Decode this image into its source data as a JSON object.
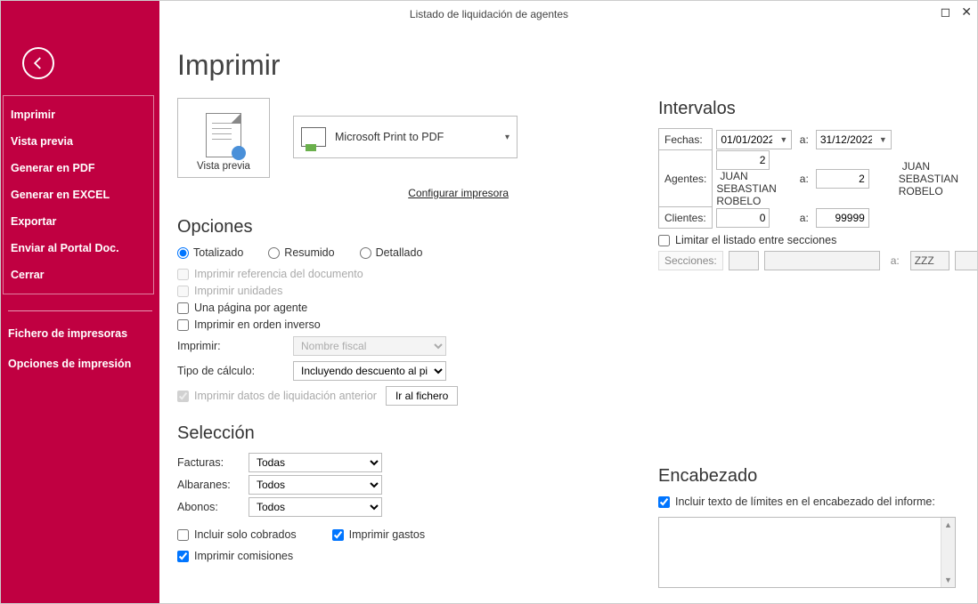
{
  "titlebar": {
    "title": "Listado de liquidación de agentes"
  },
  "sidebar": {
    "items": [
      "Imprimir",
      "Vista previa",
      "Generar en PDF",
      "Generar en EXCEL",
      "Exportar",
      "Enviar al Portal Doc.",
      "Cerrar"
    ],
    "extra": [
      "Fichero de impresoras",
      "Opciones de impresión"
    ]
  },
  "page": {
    "heading": "Imprimir"
  },
  "preview": {
    "label": "Vista previa"
  },
  "printer": {
    "name": "Microsoft Print to PDF",
    "configure": "Configurar impresora"
  },
  "opciones": {
    "title": "Opciones",
    "radios": {
      "totalizado": "Totalizado",
      "resumido": "Resumido",
      "detallado": "Detallado"
    },
    "imprimir_ref": "Imprimir referencia del documento",
    "imprimir_unidades": "Imprimir unidades",
    "una_pagina": "Una página por agente",
    "orden_inverso": "Imprimir en orden inverso",
    "imprimir_label": "Imprimir:",
    "imprimir_value": "Nombre fiscal",
    "tipo_calculo_label": "Tipo de cálculo:",
    "tipo_calculo_value": "Incluyendo descuento al pie",
    "datos_liquidacion": "Imprimir datos de liquidación anterior",
    "ir_fichero": "Ir al fichero"
  },
  "seleccion": {
    "title": "Selección",
    "facturas_label": "Facturas:",
    "facturas_value": "Todas",
    "albaranes_label": "Albaranes:",
    "albaranes_value": "Todos",
    "abonos_label": "Abonos:",
    "abonos_value": "Todos",
    "solo_cobrados": "Incluir solo cobrados",
    "imprimir_gastos": "Imprimir gastos",
    "imprimir_comisiones": "Imprimir comisiones"
  },
  "intervalos": {
    "title": "Intervalos",
    "fechas_label": "Fechas:",
    "fecha_from": "01/01/2022",
    "a": "a:",
    "fecha_to": "31/12/2022",
    "agentes_label": "Agentes:",
    "agente_from": "2",
    "agente_from_name": "JUAN SEBASTIAN ROBELO",
    "agente_to": "2",
    "agente_to_name": "JUAN SEBASTIAN ROBELO",
    "clientes_label": "Clientes:",
    "cliente_from": "0",
    "cliente_to": "99999",
    "limitar": "Limitar el listado entre secciones",
    "secciones_label": "Secciones:",
    "seccion_to": "ZZZ"
  },
  "encabezado": {
    "title": "Encabezado",
    "incluir": "Incluir texto de límites en el encabezado del informe:"
  }
}
